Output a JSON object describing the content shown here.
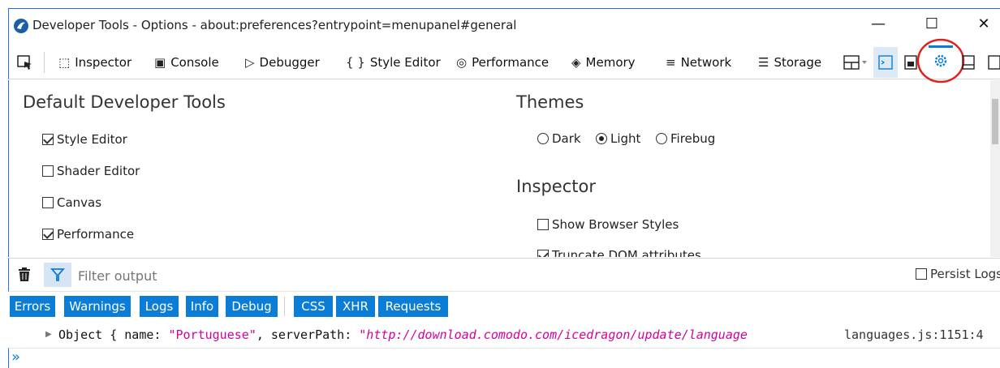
{
  "window": {
    "title": "Developer Tools - Options - about:preferences?entrypoint=menupanel#general",
    "minimize_glyph": "—",
    "maximize_glyph": "☐",
    "close_glyph": "✕"
  },
  "toolbar": {
    "tabs": [
      {
        "label": "Inspector",
        "icon": "inspector-icon"
      },
      {
        "label": "Console",
        "icon": "console-icon"
      },
      {
        "label": "Debugger",
        "icon": "debugger-icon"
      },
      {
        "label": "Style Editor",
        "icon": "style-editor-icon"
      },
      {
        "label": "Performance",
        "icon": "performance-icon"
      },
      {
        "label": "Memory",
        "icon": "memory-icon"
      },
      {
        "label": "Network",
        "icon": "network-icon"
      },
      {
        "label": "Storage",
        "icon": "storage-icon"
      }
    ],
    "glyphs": {
      "inspector": "⬚",
      "console": "▣",
      "debugger": "▷",
      "style_editor": "{ }",
      "performance": "◎",
      "memory": "◈",
      "network": "≡",
      "storage": "☰"
    },
    "active_accent": "#0b7dd6",
    "highlight_circle": "#e0201b"
  },
  "options": {
    "default_tools": {
      "heading": "Default Developer Tools",
      "items": [
        {
          "label": "Style Editor",
          "checked": true
        },
        {
          "label": "Shader Editor",
          "checked": false
        },
        {
          "label": "Canvas",
          "checked": false
        },
        {
          "label": "Performance",
          "checked": true
        }
      ]
    },
    "themes": {
      "heading": "Themes",
      "options": [
        {
          "label": "Dark",
          "selected": false
        },
        {
          "label": "Light",
          "selected": true
        },
        {
          "label": "Firebug",
          "selected": false
        }
      ]
    },
    "inspector": {
      "heading": "Inspector",
      "items": [
        {
          "label": "Show Browser Styles",
          "checked": false
        },
        {
          "label": "Truncate DOM attributes",
          "checked": true
        }
      ]
    }
  },
  "console": {
    "filter_placeholder": "Filter output",
    "persist_logs": "Persist Logs",
    "filters": [
      "Errors",
      "Warnings",
      "Logs",
      "Info",
      "Debug",
      "CSS",
      "XHR",
      "Requests"
    ],
    "log": {
      "arrow": "▶",
      "prefix": "Object { name: ",
      "name_value": "\"Portuguese\"",
      "mid": ", serverPath: ",
      "path_value": "\"http://download.comodo.com/icedragon/update/language",
      "source": "languages.js:1151:4"
    },
    "prompt": "»"
  }
}
